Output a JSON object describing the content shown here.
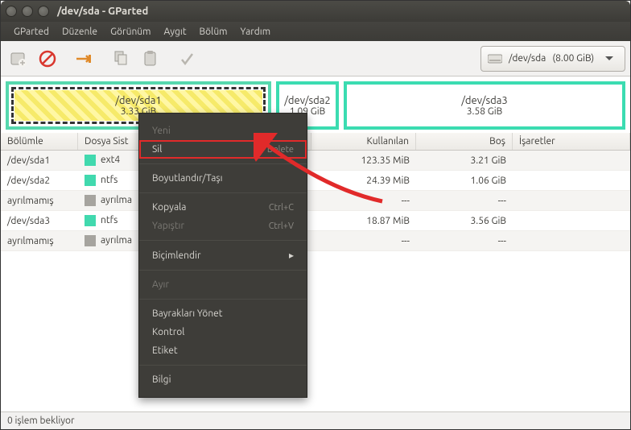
{
  "window": {
    "title": "/dev/sda - GParted"
  },
  "menubar": [
    "GParted",
    "Düzenle",
    "Görünüm",
    "Aygıt",
    "Bölüm",
    "Yardım"
  ],
  "device_selector": {
    "device": "/dev/sda",
    "size": "(8.00 GiB)"
  },
  "partitions_map": {
    "p1": {
      "name": "/dev/sda1",
      "size": "3.33 GiB"
    },
    "p2": {
      "name": "/dev/sda2",
      "size": "1.09 GiB"
    },
    "p3": {
      "name": "/dev/sda3",
      "size": "3.58 GiB"
    }
  },
  "table": {
    "headers": {
      "partition": "Bölümle",
      "fs": "Dosya Sist",
      "size": "",
      "used": "Kullanılan",
      "free": "Boş",
      "flags": "İşaretler"
    },
    "rows": [
      {
        "partition": "/dev/sda1",
        "fs": "ext4",
        "fs_color": "sw-teal",
        "size": "",
        "used": "123.35 MiB",
        "free": "3.21 GiB",
        "flags": ""
      },
      {
        "partition": "/dev/sda2",
        "fs": "ntfs",
        "fs_color": "sw-teal",
        "size": "",
        "used": "24.39 MiB",
        "free": "1.06 GiB",
        "flags": ""
      },
      {
        "partition": "ayrılmamış",
        "fs": "ayrılma",
        "fs_color": "sw-grey",
        "size": "",
        "used": "---",
        "free": "---",
        "flags": ""
      },
      {
        "partition": "/dev/sda3",
        "fs": "ntfs",
        "fs_color": "sw-teal",
        "size": "",
        "used": "18.87 MiB",
        "free": "3.56 GiB",
        "flags": ""
      },
      {
        "partition": "ayrılmamış",
        "fs": "ayrılma",
        "fs_color": "sw-grey",
        "size": "",
        "used": "---",
        "free": "---",
        "flags": ""
      }
    ]
  },
  "context_menu": {
    "yeni": "Yeni",
    "sil": "Sil",
    "sil_shortcut": "Delete",
    "boyut": "Boyutlandır/Taşı",
    "kopyala": "Kopyala",
    "kopyala_shortcut": "Ctrl+C",
    "yapistir": "Yapıştır",
    "yapistir_shortcut": "Ctrl+V",
    "bicimlendir": "Biçimlendir",
    "ayir": "Ayır",
    "bayrak": "Bayrakları Yönet",
    "kontrol": "Kontrol",
    "etiket": "Etiket",
    "bilgi": "Bilgi"
  },
  "statusbar": "0 işlem bekliyor"
}
